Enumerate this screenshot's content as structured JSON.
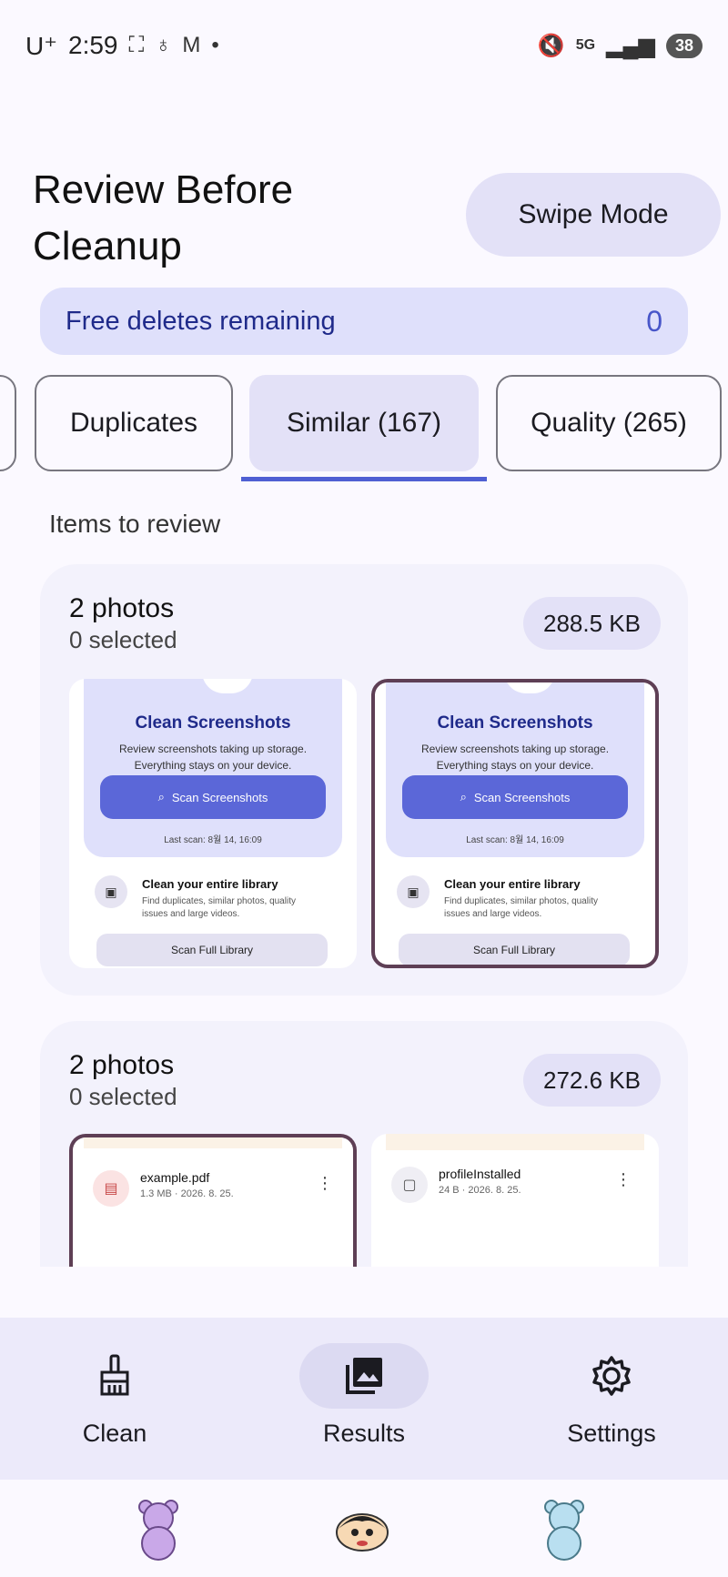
{
  "status_bar": {
    "carrier": "U⁺",
    "time": "2:59",
    "network": "5G",
    "battery": "38"
  },
  "header": {
    "title": "Review Before Cleanup",
    "swipe_mode_label": "Swipe Mode"
  },
  "free_deletes": {
    "label": "Free deletes remaining",
    "count": "0"
  },
  "tabs": [
    {
      "label": "Duplicates",
      "active": false
    },
    {
      "label": "Similar (167)",
      "active": true
    },
    {
      "label": "Quality (265)",
      "active": false
    }
  ],
  "section_label": "Items to review",
  "groups": [
    {
      "title": "2 photos",
      "selected": "0 selected",
      "size": "288.5 KB",
      "thumbs": [
        {
          "heading": "Clean Screenshots",
          "desc_line1": "Review screenshots taking up storage.",
          "desc_line2": "Everything stays on your device.",
          "button": "Scan Screenshots",
          "last_scan": "Last scan: 8월 14, 16:09",
          "lib_title": "Clean your entire library",
          "lib_desc": "Find duplicates, similar photos, quality issues and large videos.",
          "scan_full": "Scan Full Library"
        },
        {
          "heading": "Clean Screenshots",
          "desc_line1": "Review screenshots taking up storage.",
          "desc_line2": "Everything stays on your device.",
          "button": "Scan Screenshots",
          "last_scan": "Last scan: 8월 14, 16:09",
          "lib_title": "Clean your entire library",
          "lib_desc": "Find duplicates, similar photos, quality issues and large videos.",
          "scan_full": "Scan Full Library"
        }
      ]
    },
    {
      "title": "2 photos",
      "selected": "0 selected",
      "size": "272.6 KB",
      "files": [
        {
          "name": "example.pdf",
          "meta": "1.3 MB · 2026. 8. 25."
        },
        {
          "name": "profileInstalled",
          "meta": "24 B · 2026. 8. 25."
        }
      ]
    }
  ],
  "bottom_nav": [
    {
      "label": "Clean",
      "icon": "broom-icon"
    },
    {
      "label": "Results",
      "icon": "photo-library-icon"
    },
    {
      "label": "Settings",
      "icon": "gear-icon"
    }
  ],
  "colors": {
    "accent": "#4f5fd3",
    "pill": "#e3e1f7",
    "selected_border": "#5e3f55"
  }
}
